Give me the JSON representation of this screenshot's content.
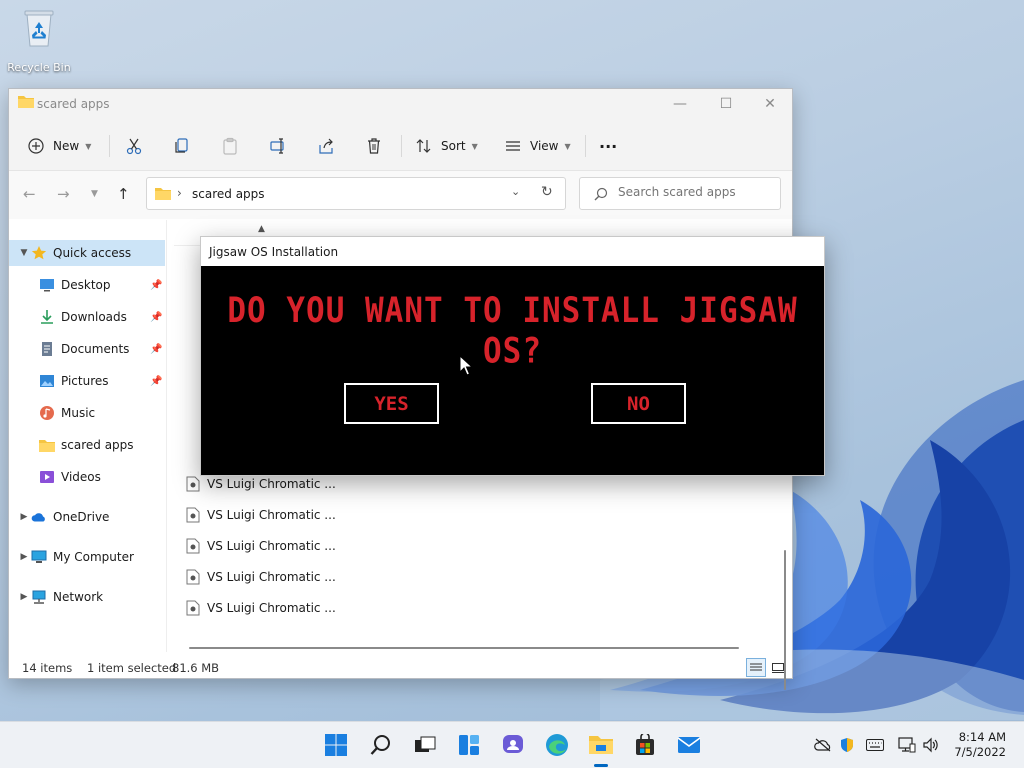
{
  "desktop": {
    "recycle_bin_label": "Recycle Bin"
  },
  "explorer": {
    "title": "scared apps",
    "window_controls": {
      "minimize": "—",
      "maximize": "☐",
      "close": "✕"
    },
    "toolbar": {
      "new_label": "New",
      "sort_label": "Sort",
      "view_label": "View",
      "more_label": "···"
    },
    "address": {
      "path": "scared apps",
      "separator": "›"
    },
    "search": {
      "placeholder": "Search scared apps"
    },
    "nav": {
      "quick_access": "Quick access",
      "items": [
        {
          "label": "Desktop",
          "icon": "desktop-icon",
          "pinned": true
        },
        {
          "label": "Downloads",
          "icon": "downloads-icon",
          "pinned": true
        },
        {
          "label": "Documents",
          "icon": "documents-icon",
          "pinned": true
        },
        {
          "label": "Pictures",
          "icon": "pictures-icon",
          "pinned": true
        },
        {
          "label": "Music",
          "icon": "music-icon",
          "pinned": false
        },
        {
          "label": "scared apps",
          "icon": "folder-icon",
          "pinned": false
        },
        {
          "label": "Videos",
          "icon": "videos-icon",
          "pinned": false
        }
      ],
      "onedrive": "OneDrive",
      "my_computer": "My Computer",
      "network": "Network"
    },
    "files": [
      "VS Luigi Chromatic ...",
      "VS Luigi Chromatic ...",
      "VS Luigi Chromatic ...",
      "VS Luigi Chromatic ...",
      "VS Luigi Chromatic ..."
    ],
    "status": {
      "items": "14 items",
      "selected": "1 item selected",
      "size": "81.6 MB"
    }
  },
  "dialog": {
    "title": "Jigsaw OS Installation",
    "question": "DO YOU WANT TO INSTALL JIGSAW OS?",
    "yes_label": "YES",
    "no_label": "NO",
    "text_color": "#d7232b"
  },
  "taskbar": {
    "apps": [
      "start-icon",
      "search-icon",
      "task-view-icon",
      "widgets-icon",
      "chat-icon",
      "edge-icon",
      "file-explorer-icon",
      "store-icon",
      "mail-icon"
    ],
    "clock": {
      "time": "8:14 AM",
      "date": "7/5/2022"
    }
  },
  "colors": {
    "accent": "#0067c0",
    "selection": "#cce4f7",
    "folder": "#f5c542"
  }
}
